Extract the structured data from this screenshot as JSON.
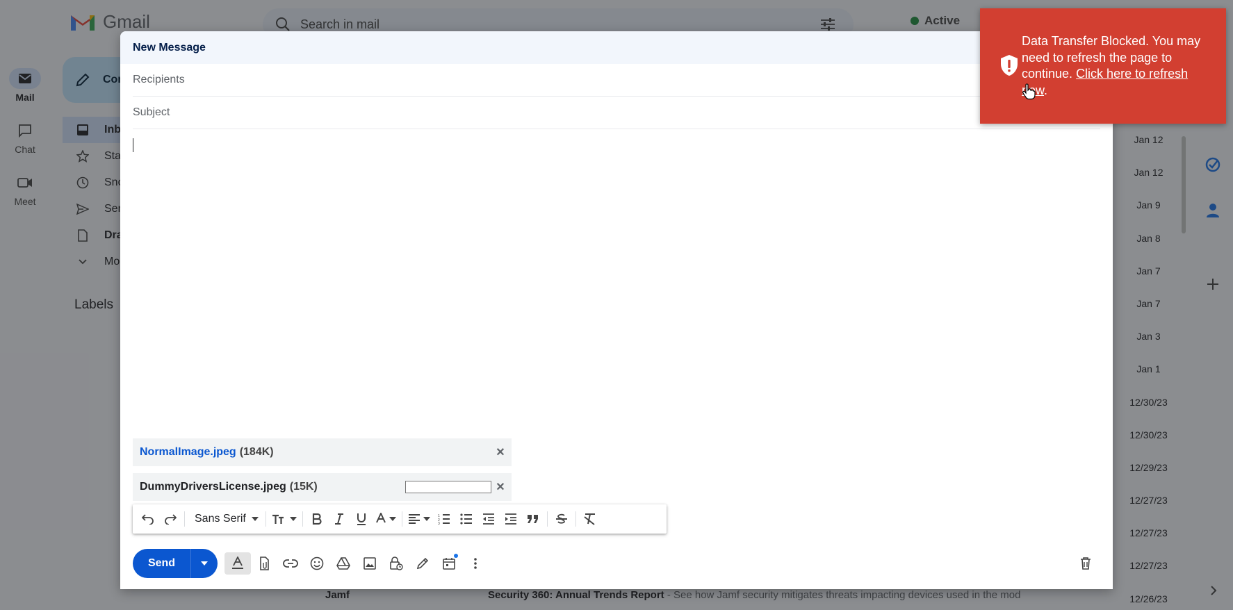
{
  "app": {
    "name": "Gmail"
  },
  "rail": {
    "items": [
      {
        "label": "Mail",
        "icon": "mail-icon"
      },
      {
        "label": "Chat",
        "icon": "chat-icon"
      },
      {
        "label": "Meet",
        "icon": "video-icon"
      }
    ]
  },
  "search": {
    "placeholder": "Search in mail"
  },
  "status": {
    "label": "Active"
  },
  "compose_button": {
    "label": "Compose"
  },
  "nav": {
    "items": [
      {
        "label": "Inbox"
      },
      {
        "label": "Starred"
      },
      {
        "label": "Snoozed"
      },
      {
        "label": "Sent"
      },
      {
        "label": "Drafts"
      },
      {
        "label": "More"
      }
    ]
  },
  "labels_heading": "Labels",
  "dates": [
    "Jan 12",
    "Jan 12",
    "Jan 9",
    "Jan 8",
    "Jan 7",
    "Jan 7",
    "Jan 3",
    "Jan 1",
    "12/30/23",
    "12/30/23",
    "12/29/23",
    "12/27/23",
    "12/27/23",
    "12/27/23",
    "12/26/23"
  ],
  "bg_row": {
    "sender": "Jamf",
    "subject": "Security 360: Annual Trends Report",
    "snippet": " - See how Jamf security mitigates threats impacting devices used in the mod"
  },
  "compose": {
    "title": "New Message",
    "recipients_placeholder": "Recipients",
    "subject_placeholder": "Subject",
    "attachments": [
      {
        "name": "NormalImage.jpeg",
        "size": "(184K)"
      },
      {
        "name": "DummyDriversLicense.jpeg",
        "size": "(15K)",
        "upload_progress": 0
      }
    ],
    "toolbar": {
      "font": "Sans Serif"
    },
    "send_label": "Send"
  },
  "toast": {
    "message": "Data Transfer Blocked. You may need to refresh the page to continue. ",
    "link": "Click here to refresh now",
    "suffix": ".",
    "color": "#d23f31"
  },
  "colors": {
    "accent": "#0b57d0",
    "toast": "#d23f31"
  }
}
